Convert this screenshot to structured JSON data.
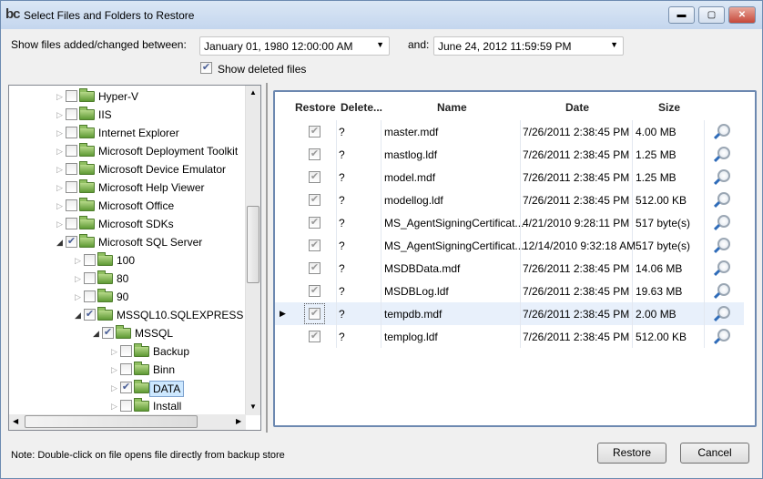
{
  "window": {
    "title": "Select Files and Folders to Restore",
    "logo": "bc",
    "minimize": "▬",
    "maximize": "▢",
    "close": "✕"
  },
  "filter": {
    "label": "Show files added/changed between:",
    "from": "January 01, 1980 12:00:00 AM",
    "and_label": "and:",
    "to": "June 24, 2012 11:59:59 PM",
    "show_deleted_label": "Show deleted files",
    "show_deleted": true
  },
  "tree": [
    {
      "label": "Hyper-V",
      "level": 0,
      "checked": false
    },
    {
      "label": "IIS",
      "level": 0,
      "checked": false
    },
    {
      "label": "Internet Explorer",
      "level": 0,
      "checked": false
    },
    {
      "label": "Microsoft Deployment Toolkit",
      "level": 0,
      "checked": false
    },
    {
      "label": "Microsoft Device Emulator",
      "level": 0,
      "checked": false
    },
    {
      "label": "Microsoft Help Viewer",
      "level": 0,
      "checked": false
    },
    {
      "label": "Microsoft Office",
      "level": 0,
      "checked": false
    },
    {
      "label": "Microsoft SDKs",
      "level": 0,
      "checked": false
    },
    {
      "label": "Microsoft SQL Server",
      "level": 0,
      "checked": true,
      "expanded": true
    },
    {
      "label": "100",
      "level": 1,
      "checked": false
    },
    {
      "label": "80",
      "level": 1,
      "checked": false
    },
    {
      "label": "90",
      "level": 1,
      "checked": false
    },
    {
      "label": "MSSQL10.SQLEXPRESS",
      "level": 1,
      "checked": true,
      "expanded": true
    },
    {
      "label": "MSSQL",
      "level": 2,
      "checked": true,
      "expanded": true
    },
    {
      "label": "Backup",
      "level": 3,
      "checked": false
    },
    {
      "label": "Binn",
      "level": 3,
      "checked": false
    },
    {
      "label": "DATA",
      "level": 3,
      "checked": true,
      "selected": true
    },
    {
      "label": "Install",
      "level": 3,
      "checked": false
    }
  ],
  "grid": {
    "columns": [
      "Restore",
      "Delete...",
      "Name",
      "Date",
      "Size"
    ],
    "rows": [
      {
        "restore": true,
        "deleted": "?",
        "name": "master.mdf",
        "date": "7/26/2011 2:38:45 PM",
        "size": "4.00 MB"
      },
      {
        "restore": true,
        "deleted": "?",
        "name": "mastlog.ldf",
        "date": "7/26/2011 2:38:45 PM",
        "size": "1.25 MB"
      },
      {
        "restore": true,
        "deleted": "?",
        "name": "model.mdf",
        "date": "7/26/2011 2:38:45 PM",
        "size": "1.25 MB"
      },
      {
        "restore": true,
        "deleted": "?",
        "name": "modellog.ldf",
        "date": "7/26/2011 2:38:45 PM",
        "size": "512.00 KB"
      },
      {
        "restore": true,
        "deleted": "?",
        "name": "MS_AgentSigningCertificat...",
        "date": "4/21/2010 9:28:11 PM",
        "size": "517 byte(s)"
      },
      {
        "restore": true,
        "deleted": "?",
        "name": "MS_AgentSigningCertificat...",
        "date": "12/14/2010 9:32:18 AM",
        "size": "517 byte(s)"
      },
      {
        "restore": true,
        "deleted": "?",
        "name": "MSDBData.mdf",
        "date": "7/26/2011 2:38:45 PM",
        "size": "14.06 MB"
      },
      {
        "restore": true,
        "deleted": "?",
        "name": "MSDBLog.ldf",
        "date": "7/26/2011 2:38:45 PM",
        "size": "19.63 MB"
      },
      {
        "restore": true,
        "deleted": "?",
        "name": "tempdb.mdf",
        "date": "7/26/2011 2:38:45 PM",
        "size": "2.00 MB",
        "current": true
      },
      {
        "restore": true,
        "deleted": "?",
        "name": "templog.ldf",
        "date": "7/26/2011 2:38:45 PM",
        "size": "512.00 KB"
      }
    ]
  },
  "footer": {
    "note": "Note: Double-click on file opens file directly from backup store",
    "restore": "Restore",
    "cancel": "Cancel"
  }
}
